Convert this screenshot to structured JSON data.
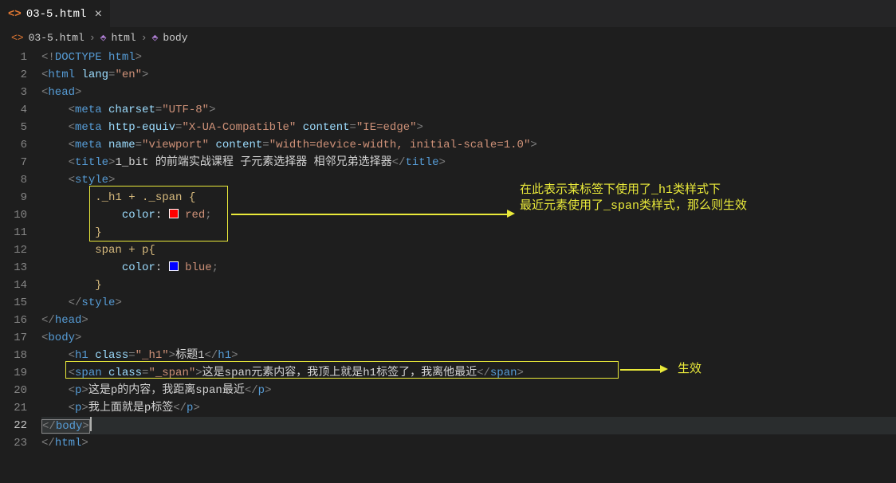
{
  "tab": {
    "filename": "03-5.html",
    "icon": "<>"
  },
  "breadcrumb": {
    "file": "03-5.html",
    "part1": "html",
    "part2": "body"
  },
  "lines": [
    "1",
    "2",
    "3",
    "4",
    "5",
    "6",
    "7",
    "8",
    "9",
    "10",
    "11",
    "12",
    "13",
    "14",
    "15",
    "16",
    "17",
    "18",
    "19",
    "20",
    "21",
    "22",
    "23"
  ],
  "code": {
    "doctype": "DOCTYPE html",
    "html_attr": "lang",
    "html_val": "\"en\"",
    "charset_attr": "charset",
    "charset_val": "\"UTF-8\"",
    "equiv_attr": "http-equiv",
    "equiv_val": "\"X-UA-Compatible\"",
    "equiv_c_attr": "content",
    "equiv_c_val": "\"IE=edge\"",
    "view_attr": "name",
    "view_val": "\"viewport\"",
    "view_c_attr": "content",
    "view_c_val": "\"width=device-width, initial-scale=1.0\"",
    "title_text": "1_bit 的前端实战课程 子元素选择器 相邻兄弟选择器",
    "sel1": "._h1 + ._span {",
    "prop_color": "color",
    "val_red": "red",
    "sel2": "span + p{",
    "val_blue": "blue",
    "h1_class_attr": "class",
    "h1_class_val": "\"_h1\"",
    "h1_text": "标题1",
    "span_class_val": "\"_span\"",
    "span_text": "这是span元素内容，我顶上就是h1标签了，我离他最近",
    "p1_text": "这是p的内容，我距离span最近",
    "p2_text": "我上面就是p标签"
  },
  "annotations": {
    "a1": "在此表示某标签下使用了_h1类样式下\n最近元素使用了_span类样式，那么则生效",
    "a2": "生效"
  }
}
